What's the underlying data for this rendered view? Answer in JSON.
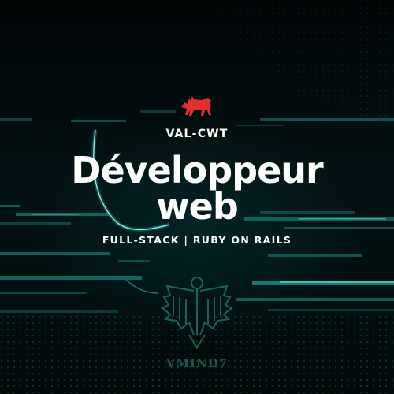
{
  "logo": {
    "icon": "red-wolf-icon",
    "color": "#e0312f"
  },
  "brand": "VAL-CWT",
  "headline": {
    "line1": "Développeur",
    "line2": "web"
  },
  "tagline": "FULL-STACK | RUBY ON RAILS",
  "watermark": {
    "icon": "eagle-emblem-icon",
    "text": "VMIND7"
  },
  "colors": {
    "accent": "#1fd6c4",
    "background": "#02080a",
    "logo": "#e0312f"
  }
}
